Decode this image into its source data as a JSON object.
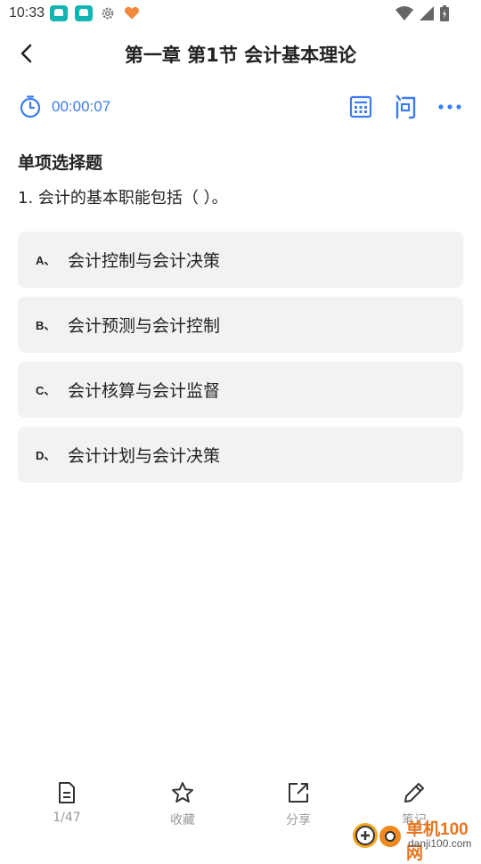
{
  "status_bar": {
    "time": "10:33"
  },
  "header": {
    "title": "第一章 第1节 会计基本理论"
  },
  "timer": {
    "elapsed": "00:00:07"
  },
  "question": {
    "type_label": "单项选择题",
    "text": "1. 会计的基本职能包括（  ）。",
    "options": [
      {
        "letter": "A、",
        "text": "会计控制与会计决策"
      },
      {
        "letter": "B、",
        "text": "会计预测与会计控制"
      },
      {
        "letter": "C、",
        "text": "会计核算与会计监督"
      },
      {
        "letter": "D、",
        "text": "会计计划与会计决策"
      }
    ]
  },
  "bottom_nav": {
    "progress": "1/47",
    "favorite": "收藏",
    "share": "分享",
    "note": "笔记"
  },
  "watermark": {
    "brand": "单机100网",
    "url": "danji100.com"
  },
  "colors": {
    "accent": "#3b7cf5",
    "option_bg": "#f2f2f2",
    "muted": "#999999"
  }
}
